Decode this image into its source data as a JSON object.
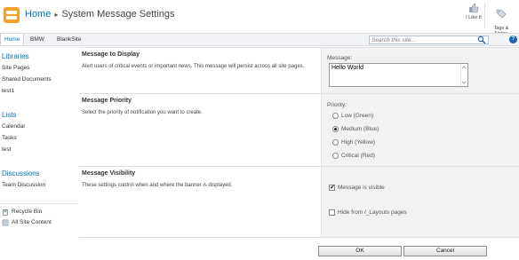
{
  "header": {
    "breadcrumb_home": "Home",
    "breadcrumb_sep": "▸",
    "breadcrumb_title": "System Message Settings",
    "like_label": "I Like It",
    "tags_label": "Tags &\nNotes"
  },
  "topnav": {
    "items": [
      "Home",
      "BMW",
      "BlankSite"
    ],
    "search_placeholder": "Search this site...",
    "help": "?"
  },
  "quicklaunch": {
    "libraries_heading": "Libraries",
    "libraries": [
      "Site Pages",
      "Shared Documents",
      "test1"
    ],
    "lists_heading": "Lists",
    "lists": [
      "Calendar",
      "Tasks",
      "test"
    ],
    "discussions_heading": "Discussions",
    "discussions": [
      "Team Discussion"
    ],
    "recycle_bin": "Recycle Bin",
    "all_site_content": "All Site Content"
  },
  "sections": {
    "message": {
      "title": "Message to Display",
      "description": "Alert users of critical events or important news. This message will persist across all site pages.",
      "field_label": "Message:",
      "value": "Hello World"
    },
    "priority": {
      "title": "Message Priority",
      "description": "Select the priority of notification you want to create.",
      "field_label": "Priority:",
      "options": [
        "Low (Green)",
        "Medium (Blue)",
        "High (Yellow)",
        "Critical (Red)"
      ],
      "selected": "Medium (Blue)"
    },
    "visibility": {
      "title": "Message Visibility",
      "description": "These settings control when and where the banner is displayed.",
      "visible_label": "Message is visible",
      "visible_checked": true,
      "hide_label": "Hide from /_Layouts pages",
      "hide_checked": false
    }
  },
  "buttons": {
    "ok": "OK",
    "cancel": "Cancel"
  },
  "colors": {
    "link": "#0072bc",
    "logo": "#f2a02e"
  }
}
